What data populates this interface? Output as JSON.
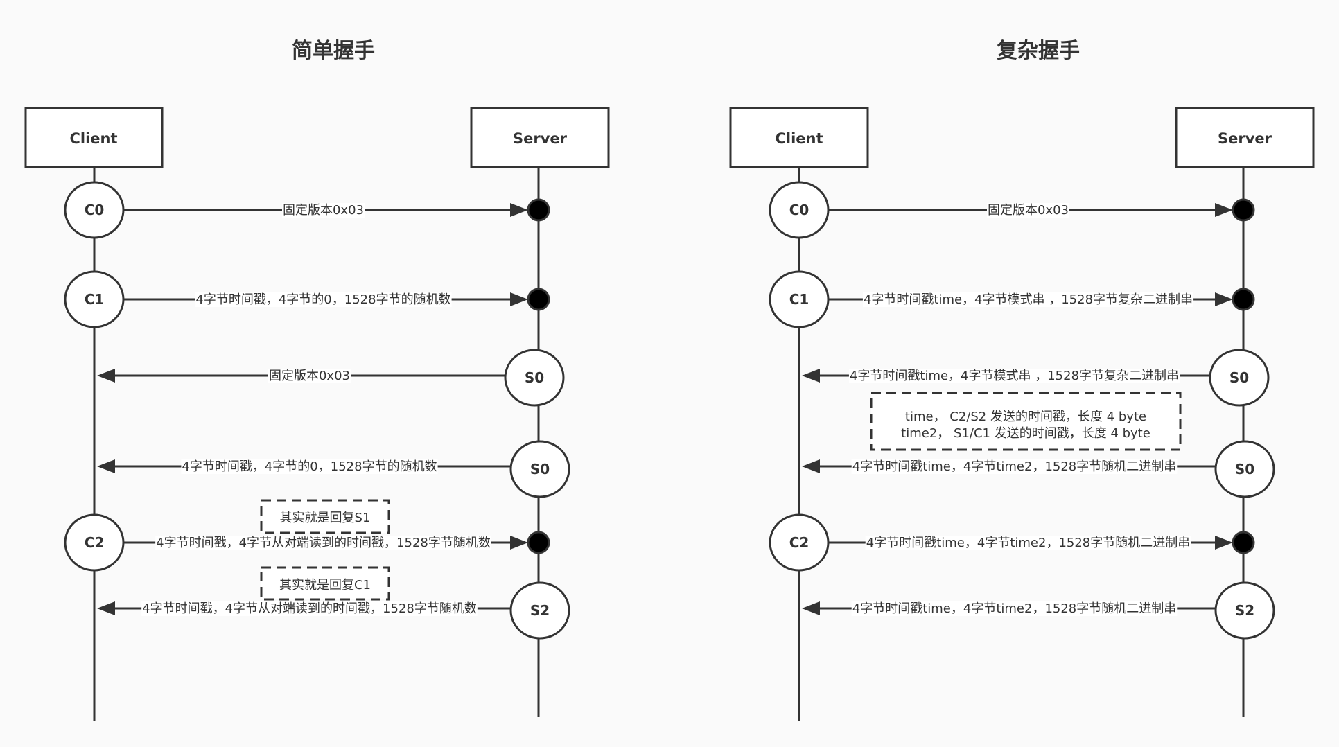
{
  "diagrams": [
    {
      "title": "简单握手",
      "client_label": "Client",
      "server_label": "Server",
      "steps": [
        {
          "node": "C0",
          "side": "client",
          "direction": "to-server",
          "message": "固定版本0x03"
        },
        {
          "node": "C1",
          "side": "client",
          "direction": "to-server",
          "message": "4字节时间戳，4字节的0，1528字节的随机数"
        },
        {
          "node": "S0",
          "side": "server",
          "direction": "to-client",
          "message": "固定版本0x03"
        },
        {
          "node": "S0",
          "side": "server",
          "direction": "to-client",
          "message": "4字节时间戳，4字节的0，1528字节的随机数"
        },
        {
          "node": "C2",
          "side": "client",
          "direction": "to-server",
          "message": "4字节时间戳，4字节从对端读到的时间戳，1528字节随机数"
        },
        {
          "node": "S2",
          "side": "server",
          "direction": "to-client",
          "message": "4字节时间戳，4字节从对端读到的时间戳，1528字节随机数"
        }
      ],
      "notes": [
        {
          "lines": [
            "其实就是回复S1"
          ]
        },
        {
          "lines": [
            "其实就是回复C1"
          ]
        }
      ]
    },
    {
      "title": "复杂握手",
      "client_label": "Client",
      "server_label": "Server",
      "steps": [
        {
          "node": "C0",
          "side": "client",
          "direction": "to-server",
          "message": "固定版本0x03"
        },
        {
          "node": "C1",
          "side": "client",
          "direction": "to-server",
          "message": "4字节时间戳time，4字节模式串 ，1528字节复杂二进制串"
        },
        {
          "node": "S0",
          "side": "server",
          "direction": "to-client",
          "message": "4字节时间戳time，4字节模式串 ，1528字节复杂二进制串"
        },
        {
          "node": "S0",
          "side": "server",
          "direction": "to-client",
          "message": "4字节时间戳time，4字节time2，1528字节随机二进制串"
        },
        {
          "node": "C2",
          "side": "client",
          "direction": "to-server",
          "message": "4字节时间戳time，4字节time2，1528字节随机二进制串"
        },
        {
          "node": "S2",
          "side": "server",
          "direction": "to-client",
          "message": "4字节时间戳time，4字节time2，1528字节随机二进制串"
        }
      ],
      "notes": [
        {
          "lines": [
            "time， C2/S2 发送的时间戳，长度 4 byte",
            "time2， S1/C1 发送的时间戳，长度 4 byte"
          ]
        }
      ]
    }
  ],
  "colors": {
    "background": "#fafafa",
    "stroke": "#333333",
    "fill": "#ffffff",
    "dot": "#000000"
  }
}
